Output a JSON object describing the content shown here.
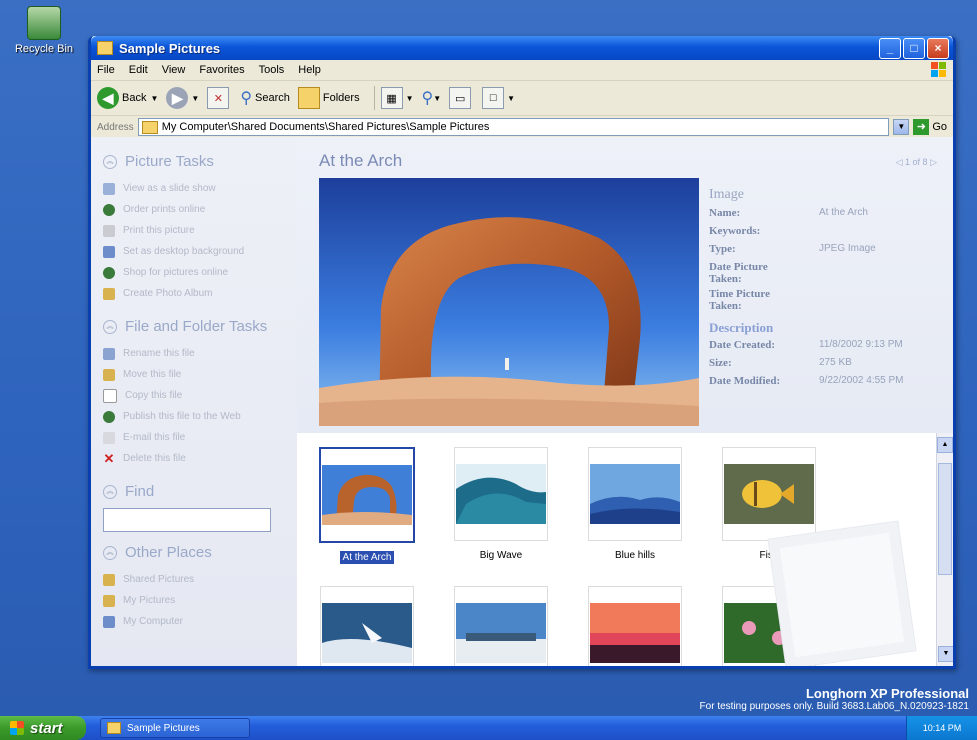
{
  "desktop": {
    "recycle_bin_label": "Recycle Bin"
  },
  "window": {
    "title": "Sample Pictures",
    "menu": [
      "File",
      "Edit",
      "View",
      "Favorites",
      "Tools",
      "Help"
    ],
    "toolbar": {
      "back": "Back",
      "search": "Search",
      "folders": "Folders"
    },
    "address": {
      "label": "Address",
      "path": "My Computer\\Shared Documents\\Shared Pictures\\Sample Pictures",
      "go": "Go"
    }
  },
  "left_pane": {
    "picture_tasks": {
      "title": "Picture Tasks",
      "items": [
        "View as a slide show",
        "Order prints online",
        "Print this picture",
        "Set as desktop background",
        "Shop for pictures online",
        "Create Photo Album"
      ]
    },
    "file_tasks": {
      "title": "File and Folder Tasks",
      "items": [
        "Rename this file",
        "Move this file",
        "Copy this file",
        "Publish this file to the Web",
        "E-mail this file",
        "Delete this file"
      ]
    },
    "find": {
      "title": "Find"
    },
    "other_places": {
      "title": "Other Places",
      "items": [
        "Shared Pictures",
        "My Pictures",
        "My Computer"
      ]
    }
  },
  "preview": {
    "title": "At the Arch",
    "pager": "1 of 8",
    "image_header": "Image",
    "fields": [
      {
        "k": "Name:",
        "v": "At the Arch"
      },
      {
        "k": "Keywords:",
        "v": ""
      },
      {
        "k": "Type:",
        "v": "JPEG Image"
      },
      {
        "k": "Date Picture Taken:",
        "v": ""
      },
      {
        "k": "Time Picture Taken:",
        "v": ""
      }
    ],
    "description_header": "Description",
    "desc_fields": [
      {
        "k": "Date Created:",
        "v": "11/8/2002 9:13 PM"
      },
      {
        "k": "Size:",
        "v": "275 KB"
      },
      {
        "k": "Date Modified:",
        "v": "9/22/2002 4:55 PM"
      }
    ]
  },
  "thumbnails": [
    {
      "label": "At the Arch",
      "selected": true
    },
    {
      "label": "Big Wave"
    },
    {
      "label": "Blue hills"
    },
    {
      "label": "Fish"
    },
    {
      "label": ""
    },
    {
      "label": ""
    },
    {
      "label": ""
    },
    {
      "label": ""
    }
  ],
  "watermark": {
    "line1": "Longhorn XP Professional",
    "line2": "For testing purposes only. Build 3683.Lab06_N.020923-1821"
  },
  "taskbar": {
    "start": "start",
    "task": "Sample Pictures",
    "clock": "10:14 PM"
  }
}
